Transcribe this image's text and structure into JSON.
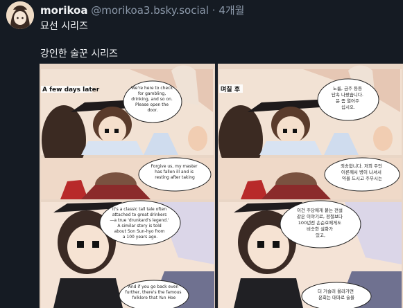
{
  "post": {
    "author_name": "morikoa",
    "author_handle": "@morikoa3.bsky.social",
    "separator": "·",
    "time": "4개월",
    "text_line1": "묘선 시리즈",
    "text_line2": "강인한 술꾼 시리즈"
  },
  "comic": {
    "left": {
      "caption": "A few days later",
      "bubble1": [
        "We're here to check",
        "for gambling,",
        "drinking, and so on.",
        "Please open the",
        "door."
      ],
      "bubble2": [
        "Forgive us, my master",
        "has fallen ill and is",
        "resting after taking"
      ],
      "bubble3": [
        "It's a classic tall tale often",
        "attached to great drinkers",
        "—a true 'drunkard's legend.'",
        "A similar story is told",
        "about Son Sun-hyo from",
        "a 100 years ago."
      ],
      "bubble4": [
        "And if you go back even",
        "further, there's the famous",
        "folklore that Yun Hoe"
      ]
    },
    "right": {
      "caption": "며칠 후",
      "bubble1": [
        "노름, 금주 등등",
        "단속 나왔습니다.",
        "문 좀 열어주",
        "십시오."
      ],
      "bubble2": [
        "죄송합니다. 저희 주인",
        "어른께서 병이 나셔서",
        "약을 드시고 주무시는"
      ],
      "bubble3": [
        "이건 주당에게 붙는 전설",
        "같은 이야기로, 정철보다",
        "100년전 손순효에게도",
        "비슷한 설화가",
        "있고,"
      ],
      "bubble4": [
        "더 거슬러 올라가면",
        "윤회는 대마로 술을"
      ]
    }
  },
  "colors": {
    "background": "#151b23",
    "text_primary": "#f1f3f5",
    "text_secondary": "#8b98a9"
  }
}
